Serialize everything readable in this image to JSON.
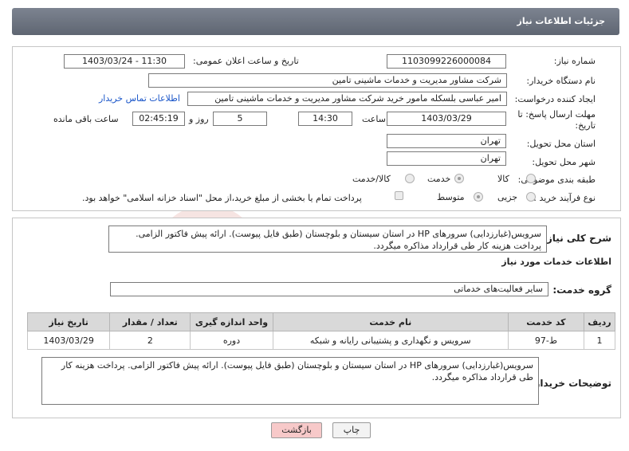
{
  "header": {
    "title": "جزئیات اطلاعات نیاز"
  },
  "fields": {
    "need_number_label": "شماره نیاز:",
    "need_number": "1103099226000084",
    "announce_label": "تاریخ و ساعت اعلان عمومی:",
    "announce_value": "1403/03/24 - 11:30",
    "buyer_org_label": "نام دستگاه خریدار:",
    "buyer_org": "شرکت مشاور مدیریت و خدمات ماشینی تامین",
    "creator_label": "ایجاد کننده درخواست:",
    "creator": "امیر عباسی بلسکله مامور خرید شرکت مشاور مدیریت و خدمات ماشینی تامین",
    "contact_link": "اطلاعات تماس خریدار",
    "deadline_label_1": "مهلت ارسال پاسخ: تا",
    "deadline_label_2": "تاریخ:",
    "deadline_date": "1403/03/29",
    "time_label": "ساعت",
    "deadline_time": "14:30",
    "days_value": "5",
    "days_label": "روز و",
    "remaining_time": "02:45:19",
    "remaining_label": "ساعت باقی مانده",
    "province_label": "استان محل تحویل:",
    "province": "تهران",
    "city_label": "شهر محل تحویل:",
    "city": "تهران",
    "category_label": "طبقه بندی موضوعی:",
    "category_options": [
      "کالا",
      "خدمت",
      "کالا/خدمت"
    ],
    "process_label": "نوع فرآیند خرید :",
    "process_options": [
      "جزیی",
      "متوسط"
    ],
    "payment_note": "پرداخت تمام یا بخشی از مبلغ خرید،از محل \"اسناد خزانه اسلامی\" خواهد بود."
  },
  "summary": {
    "label": "شرح کلی نیاز:",
    "text": "سرویس(غبارزدایی) سرورهای HP در استان سیستان و بلوچستان (طبق فایل پیوست). ارائه پیش فاکتور الزامی. پرداخت هزینه کار طی قرارداد مذاکره میگردد."
  },
  "services": {
    "section_title": "اطلاعات خدمات مورد نیاز",
    "group_label": "گروه خدمت:",
    "group_value": "سایر فعالیت‌های خدماتی",
    "columns": [
      "ردیف",
      "کد خدمت",
      "نام خدمت",
      "واحد اندازه گیری",
      "تعداد / مقدار",
      "تاریخ نیاز"
    ],
    "rows": [
      {
        "row": "1",
        "code": "ط-97",
        "name": "سرویس و نگهداری و پشتیبانی رایانه و شبکه",
        "unit": "دوره",
        "qty": "2",
        "date": "1403/03/29"
      }
    ]
  },
  "buyer_notes": {
    "label": "توضیحات خریدار:",
    "text": "سرویس(غبارزدایی) سرورهای HP در استان سیستان و بلوچستان (طبق فایل پیوست). ارائه پیش فاکتور الزامی. پرداخت هزینه کار طی قرارداد مذاکره میگردد."
  },
  "buttons": {
    "print": "چاپ",
    "back": "بازگشت"
  },
  "colors": {
    "header_bg": "#6b7280",
    "link": "#1a56c9",
    "back_button": "#f7c9c9",
    "watermark": "#c0392b"
  }
}
